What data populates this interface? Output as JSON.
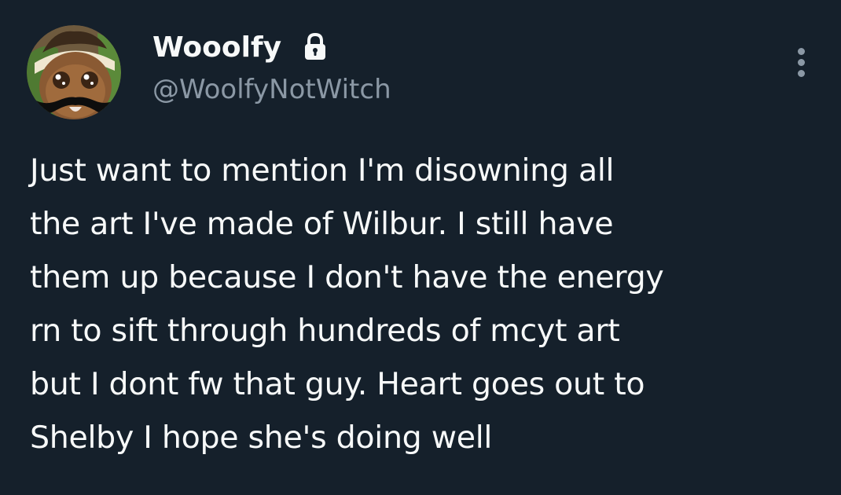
{
  "tweet": {
    "author": {
      "display_name": "Wooolfy",
      "handle": "@WoolfyNotWitch",
      "protected_icon": "lock-icon",
      "avatar": "avatar-image"
    },
    "menu_icon": "more-options-icon",
    "text_lines": [
      "Just want to mention I'm disowning all",
      "the art I've made of Wilbur. I still have",
      "them up because I don't have the energy",
      "rn to sift through hundreds of mcyt art",
      "but I dont fw that guy. Heart goes out to",
      "Shelby I hope she's doing well"
    ]
  },
  "colors": {
    "background": "#15202b",
    "primary_text": "#f7f9f9",
    "secondary_text": "#8b98a5"
  }
}
